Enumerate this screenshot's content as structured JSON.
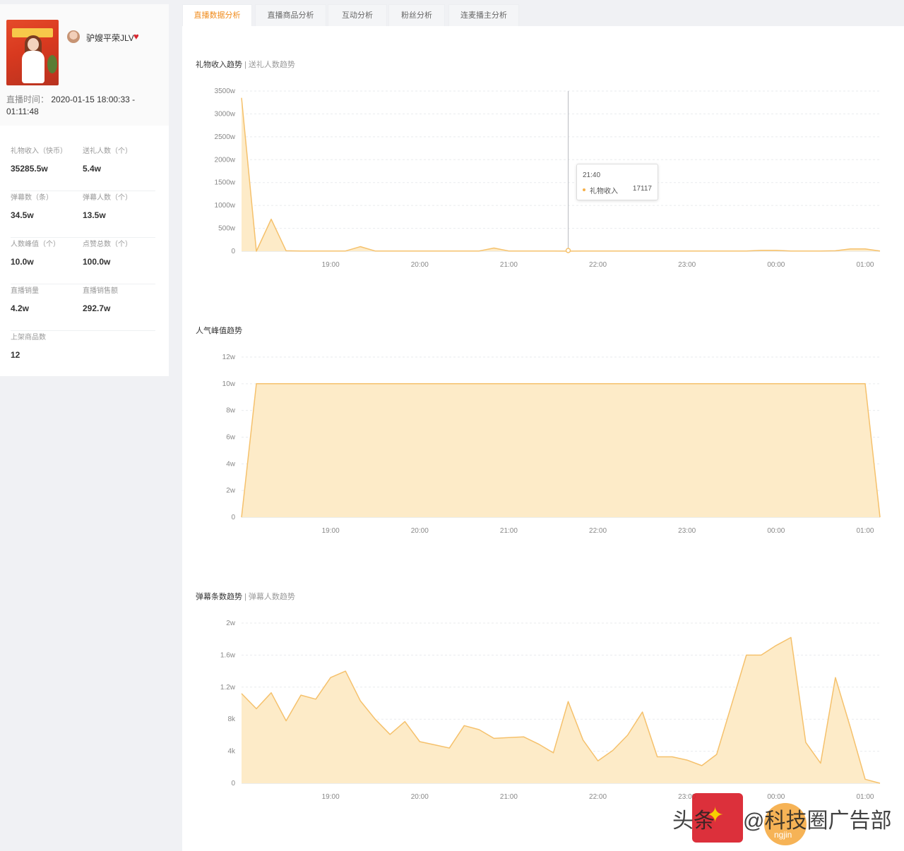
{
  "streamer": {
    "name": "驴嫂平荣JLV",
    "live_time_label": "直播时间：",
    "live_time_value": "2020-01-15 18:00:33 - 01:11:48",
    "heart_icon": "heart-icon",
    "cover_banner_color": "#f7c84a"
  },
  "stats": [
    [
      {
        "label": "礼物收入（快币）",
        "value": "35285.5w"
      },
      {
        "label": "送礼人数（个）",
        "value": "5.4w"
      }
    ],
    [
      {
        "label": "弹幕数（条）",
        "value": "34.5w"
      },
      {
        "label": "弹幕人数（个）",
        "value": "13.5w"
      }
    ],
    [
      {
        "label": "人数峰值（个）",
        "value": "10.0w"
      },
      {
        "label": "点赞总数（个）",
        "value": "100.0w"
      }
    ],
    [
      {
        "label": "直播销量",
        "value": "4.2w"
      },
      {
        "label": "直播销售额",
        "value": "292.7w"
      }
    ],
    [
      {
        "label": "上架商品数",
        "value": "12"
      }
    ]
  ],
  "tabs": [
    {
      "label": "直播数据分析",
      "active": true
    },
    {
      "label": "直播商品分析",
      "active": false
    },
    {
      "label": "互动分析",
      "active": false
    },
    {
      "label": "粉丝分析",
      "active": false
    },
    {
      "label": "连麦播主分析",
      "active": false
    }
  ],
  "charts": [
    {
      "title": "礼物收入趋势",
      "alt_title": "送礼人数趋势"
    },
    {
      "title": "人气峰值趋势",
      "alt_title": ""
    },
    {
      "title": "弹幕条数趋势",
      "alt_title": "弹幕人数趋势"
    }
  ],
  "tooltip": {
    "time": "21:40",
    "series": "礼物收入",
    "value": "17117"
  },
  "watermark": {
    "text1": "头条",
    "text2": "@科技圈广告部",
    "text3": "ngjin"
  },
  "colors": {
    "accent": "#f08c1e",
    "area_fill": "#fdebc8",
    "area_stroke": "#f5c16c"
  },
  "chart_data": [
    {
      "type": "area",
      "title": "礼物收入趋势",
      "x": [
        "18:00",
        "18:10",
        "18:20",
        "18:30",
        "18:40",
        "18:50",
        "19:00",
        "19:10",
        "19:20",
        "19:30",
        "19:40",
        "19:50",
        "20:00",
        "20:10",
        "20:20",
        "20:30",
        "20:40",
        "20:50",
        "21:00",
        "21:10",
        "21:20",
        "21:30",
        "21:40",
        "21:50",
        "22:00",
        "22:10",
        "22:20",
        "22:30",
        "22:40",
        "22:50",
        "23:00",
        "23:10",
        "23:20",
        "23:30",
        "23:40",
        "23:50",
        "00:00",
        "00:10",
        "00:20",
        "00:30",
        "00:40",
        "00:50",
        "01:00",
        "01:10"
      ],
      "series": [
        {
          "values": [
            3350,
            0,
            700,
            10,
            5,
            5,
            5,
            5,
            100,
            5,
            5,
            5,
            5,
            5,
            5,
            5,
            5,
            70,
            5,
            5,
            5,
            5,
            2,
            5,
            5,
            5,
            5,
            5,
            5,
            5,
            5,
            5,
            5,
            5,
            5,
            20,
            20,
            5,
            5,
            5,
            10,
            50,
            50,
            5
          ]
        }
      ],
      "y_ticks": [
        "0",
        "500w",
        "1000w",
        "1500w",
        "2000w",
        "2500w",
        "3000w",
        "3500w"
      ],
      "x_ticks": [
        "19:00",
        "20:00",
        "21:00",
        "22:00",
        "23:00",
        "00:00",
        "01:00"
      ],
      "ylim": [
        0,
        3500
      ],
      "grid": true
    },
    {
      "type": "area",
      "title": "人气峰值趋势",
      "x": [
        "18:00",
        "18:10",
        "01:00",
        "01:10"
      ],
      "series": [
        {
          "values": [
            0,
            10,
            10,
            0
          ]
        }
      ],
      "y_ticks": [
        "0",
        "2w",
        "4w",
        "6w",
        "8w",
        "10w",
        "12w"
      ],
      "x_ticks": [
        "19:00",
        "20:00",
        "21:00",
        "22:00",
        "23:00",
        "00:00",
        "01:00"
      ],
      "ylim": [
        0,
        12
      ],
      "grid": true
    },
    {
      "type": "area",
      "title": "弹幕条数趋势",
      "x": [
        "18:00",
        "18:10",
        "18:20",
        "18:30",
        "18:40",
        "18:50",
        "19:00",
        "19:10",
        "19:20",
        "19:30",
        "19:40",
        "19:50",
        "20:00",
        "20:10",
        "20:20",
        "20:30",
        "20:40",
        "20:50",
        "21:00",
        "21:10",
        "21:20",
        "21:30",
        "21:40",
        "21:50",
        "22:00",
        "22:10",
        "22:20",
        "22:30",
        "22:40",
        "22:50",
        "23:00",
        "23:10",
        "23:20",
        "23:30",
        "23:40",
        "23:50",
        "00:00",
        "00:10",
        "00:20",
        "00:30",
        "00:40",
        "00:50",
        "01:00",
        "01:10"
      ],
      "series": [
        {
          "values": [
            11200,
            9300,
            11300,
            7800,
            11000,
            10500,
            13200,
            14000,
            10300,
            8000,
            6100,
            7700,
            5200,
            4800,
            4400,
            7200,
            6700,
            5600,
            5700,
            5800,
            4900,
            3800,
            10200,
            5400,
            2800,
            4100,
            6000,
            8900,
            3300,
            3300,
            2900,
            2200,
            3600,
            9800,
            16000,
            16000,
            17200,
            18200,
            5100,
            2500,
            13200,
            7000,
            500,
            0
          ]
        }
      ],
      "y_ticks": [
        "0",
        "4k",
        "8k",
        "1.2w",
        "1.6w",
        "2w"
      ],
      "x_ticks": [
        "19:00",
        "20:00",
        "21:00",
        "22:00",
        "23:00",
        "00:00",
        "01:00"
      ],
      "ylim": [
        0,
        20000
      ],
      "grid": true
    }
  ]
}
